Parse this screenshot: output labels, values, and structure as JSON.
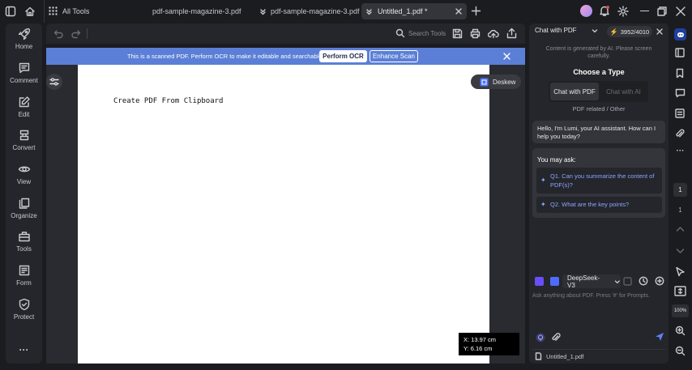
{
  "titlebar": {
    "all_tools": "All Tools",
    "tabs": [
      {
        "label": "pdf-sample-magazine-3.pdf"
      },
      {
        "label": "pdf-sample-magazine-3.pdf *"
      },
      {
        "label": "Untitled_1.pdf *"
      }
    ]
  },
  "sidebar": {
    "items": [
      {
        "label": "Home",
        "icon": "rocket-icon"
      },
      {
        "label": "Comment",
        "icon": "comment-icon"
      },
      {
        "label": "Edit",
        "icon": "edit-icon"
      },
      {
        "label": "Convert",
        "icon": "convert-icon"
      },
      {
        "label": "View",
        "icon": "eye-icon"
      },
      {
        "label": "Organize",
        "icon": "organize-icon"
      },
      {
        "label": "Tools",
        "icon": "toolbox-icon"
      },
      {
        "label": "Form",
        "icon": "form-icon"
      },
      {
        "label": "Protect",
        "icon": "shield-icon"
      }
    ],
    "more": "···"
  },
  "toolbar": {
    "search_label": "Search Tools"
  },
  "banner": {
    "message": "This is a scanned PDF. Perform OCR to make it editable and searchable.",
    "ocr_button": "Perform OCR",
    "enhance_button": "Enhance Scan"
  },
  "document": {
    "text": "Create PDF From Clipboard",
    "deskew_label": "Deskew",
    "coord_x": "X: 13.97 cm",
    "coord_y": "Y: 6.16 cm"
  },
  "chat": {
    "mode_label": "Chat with PDF",
    "credits": "3952/4010",
    "disclaimer": "Content is generated by AI. Please screen carefully.",
    "choose_type": "Choose a Type",
    "type_options": [
      {
        "label": "Chat with PDF",
        "selected": true
      },
      {
        "label": "Chat with AI",
        "selected": false
      }
    ],
    "type_caption": "PDF related / Other",
    "greeting": "Hello, I'm Lumi, your AI assistant. How can I help you today?",
    "ask_title": "You may ask:",
    "questions": [
      "Q1. Can you summarize the content of PDF(s)?",
      "Q2. What are the key points?"
    ],
    "model": "DeepSeek-V3",
    "input_placeholder": "Ask anything about PDF. Press '#' for Prompts.",
    "attached_file": "Untitled_1.pdf"
  },
  "rightbar": {
    "page_current": "1",
    "page_total": "1",
    "zoom": "100%"
  },
  "colors": {
    "accent": "#5b7fd6",
    "link": "#8ba6ff",
    "panel": "#25262b",
    "background": "#1b1c20"
  }
}
